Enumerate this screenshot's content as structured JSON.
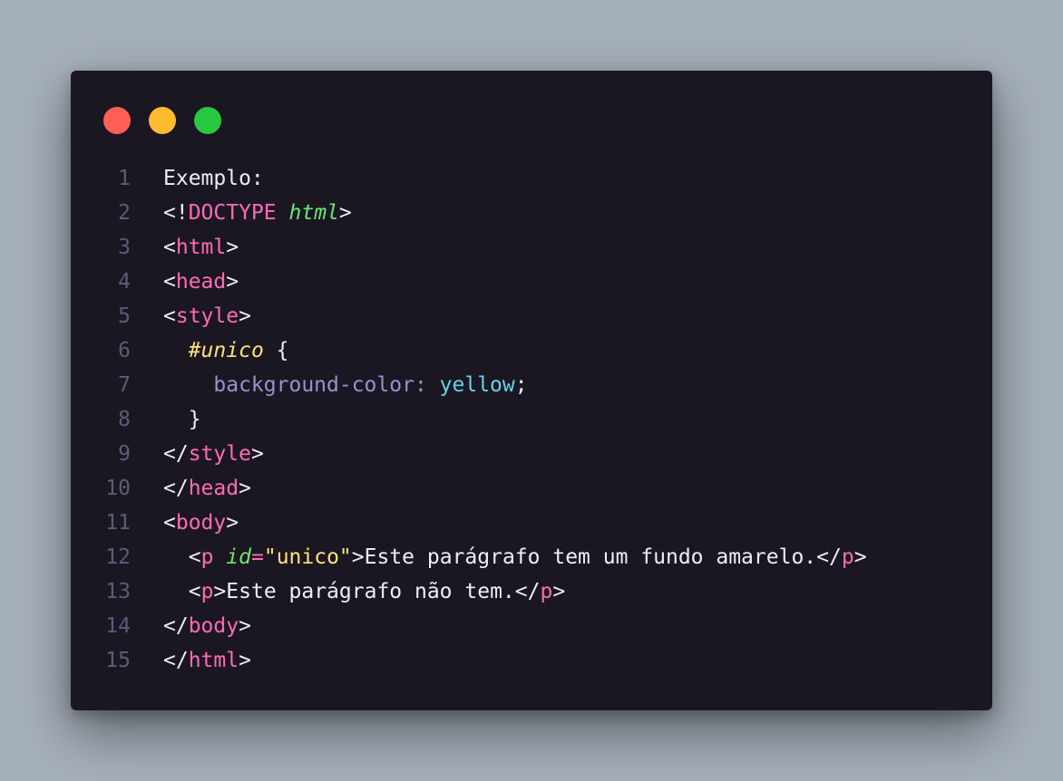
{
  "window": {
    "controls": [
      {
        "name": "close",
        "color": "#ff5f57"
      },
      {
        "name": "minimize",
        "color": "#febc2e"
      },
      {
        "name": "maximize",
        "color": "#28c840"
      }
    ]
  },
  "colors": {
    "background": "#a6b0bb",
    "window": "#1b1722",
    "line_number": "#5e5a78",
    "text": "#efedf5",
    "tag": "#ff6ab7",
    "attribute": "#6ee66e",
    "selector": "#ffe27a",
    "property": "#9c8fd0",
    "value": "#65d3e7",
    "string": "#ffe27a"
  },
  "code": {
    "lines": [
      {
        "n": "1",
        "indent": "",
        "tokens": [
          {
            "t": "plain",
            "v": "Exemplo:"
          }
        ]
      },
      {
        "n": "2",
        "indent": "",
        "tokens": [
          {
            "t": "punct",
            "v": "<!"
          },
          {
            "t": "keyword",
            "v": "DOCTYPE"
          },
          {
            "t": "plain",
            "v": " "
          },
          {
            "t": "doctype-arg",
            "v": "html"
          },
          {
            "t": "punct",
            "v": ">"
          }
        ]
      },
      {
        "n": "3",
        "indent": "",
        "tokens": [
          {
            "t": "punct",
            "v": "<"
          },
          {
            "t": "tag",
            "v": "html"
          },
          {
            "t": "punct",
            "v": ">"
          }
        ]
      },
      {
        "n": "4",
        "indent": "",
        "tokens": [
          {
            "t": "punct",
            "v": "<"
          },
          {
            "t": "tag",
            "v": "head"
          },
          {
            "t": "punct",
            "v": ">"
          }
        ]
      },
      {
        "n": "5",
        "indent": "",
        "tokens": [
          {
            "t": "punct",
            "v": "<"
          },
          {
            "t": "tag",
            "v": "style"
          },
          {
            "t": "punct",
            "v": ">"
          }
        ]
      },
      {
        "n": "6",
        "indent": "  ",
        "tokens": [
          {
            "t": "selector",
            "v": "#unico"
          },
          {
            "t": "plain",
            "v": " {"
          }
        ]
      },
      {
        "n": "7",
        "indent": "    ",
        "tokens": [
          {
            "t": "property",
            "v": "background-color:"
          },
          {
            "t": "plain",
            "v": " "
          },
          {
            "t": "value",
            "v": "yellow"
          },
          {
            "t": "plain",
            "v": ";"
          }
        ]
      },
      {
        "n": "8",
        "indent": "  ",
        "tokens": [
          {
            "t": "plain",
            "v": "}"
          }
        ]
      },
      {
        "n": "9",
        "indent": "",
        "tokens": [
          {
            "t": "punct",
            "v": "</"
          },
          {
            "t": "tag",
            "v": "style"
          },
          {
            "t": "punct",
            "v": ">"
          }
        ]
      },
      {
        "n": "10",
        "indent": "",
        "tokens": [
          {
            "t": "punct",
            "v": "</"
          },
          {
            "t": "tag",
            "v": "head"
          },
          {
            "t": "punct",
            "v": ">"
          }
        ]
      },
      {
        "n": "11",
        "indent": "",
        "tokens": [
          {
            "t": "punct",
            "v": "<"
          },
          {
            "t": "tag",
            "v": "body"
          },
          {
            "t": "punct",
            "v": ">"
          }
        ]
      },
      {
        "n": "12",
        "indent": "  ",
        "tokens": [
          {
            "t": "punct",
            "v": "<"
          },
          {
            "t": "tag",
            "v": "p"
          },
          {
            "t": "plain",
            "v": " "
          },
          {
            "t": "attr",
            "v": "id"
          },
          {
            "t": "equals",
            "v": "="
          },
          {
            "t": "string",
            "v": "\"unico\""
          },
          {
            "t": "punct",
            "v": ">"
          },
          {
            "t": "text",
            "v": "Este parágrafo tem um fundo amarelo."
          },
          {
            "t": "punct",
            "v": "</"
          },
          {
            "t": "tag",
            "v": "p"
          },
          {
            "t": "punct",
            "v": ">"
          }
        ]
      },
      {
        "n": "13",
        "indent": "  ",
        "tokens": [
          {
            "t": "punct",
            "v": "<"
          },
          {
            "t": "tag",
            "v": "p"
          },
          {
            "t": "punct",
            "v": ">"
          },
          {
            "t": "text",
            "v": "Este parágrafo não tem."
          },
          {
            "t": "punct",
            "v": "</"
          },
          {
            "t": "tag",
            "v": "p"
          },
          {
            "t": "punct",
            "v": ">"
          }
        ]
      },
      {
        "n": "14",
        "indent": "",
        "tokens": [
          {
            "t": "punct",
            "v": "</"
          },
          {
            "t": "tag",
            "v": "body"
          },
          {
            "t": "punct",
            "v": ">"
          }
        ]
      },
      {
        "n": "15",
        "indent": "",
        "tokens": [
          {
            "t": "punct",
            "v": "</"
          },
          {
            "t": "tag",
            "v": "html"
          },
          {
            "t": "punct",
            "v": ">"
          }
        ]
      }
    ]
  }
}
